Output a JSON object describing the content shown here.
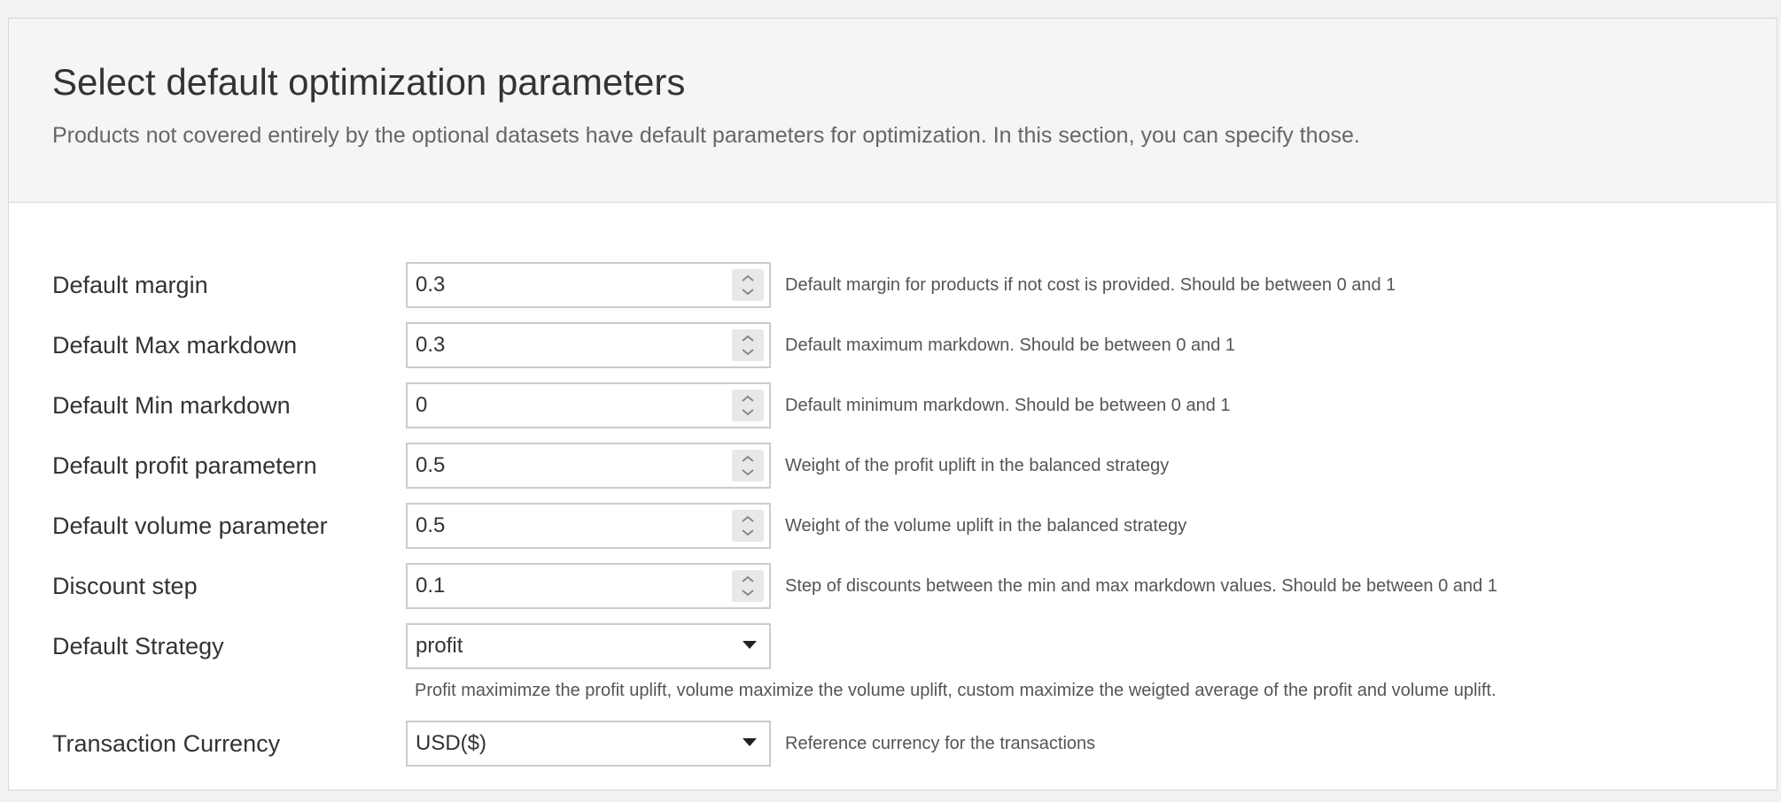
{
  "section": {
    "title": "Select default optimization parameters",
    "description": "Products not covered entirely by the optional datasets have default parameters for optimization. In this section, you can specify those."
  },
  "fields": [
    {
      "label": "Default margin",
      "value": "0.3",
      "help": "Default margin for products if not cost is provided. Should be between 0 and 1"
    },
    {
      "label": "Default Max markdown",
      "value": "0.3",
      "help": "Default maximum markdown. Should be between 0 and 1"
    },
    {
      "label": "Default Min markdown",
      "value": "0",
      "help": "Default minimum markdown. Should be between 0 and 1"
    },
    {
      "label": "Default profit parametern",
      "value": "0.5",
      "help": "Weight of the profit uplift in the balanced strategy"
    },
    {
      "label": "Default volume parameter",
      "value": "0.5",
      "help": "Weight of the volume uplift in the balanced strategy"
    },
    {
      "label": "Discount step",
      "value": "0.1",
      "help": "Step of discounts between the min and max markdown values. Should be between 0 and 1"
    }
  ],
  "strategy": {
    "label": "Default Strategy",
    "selected": "profit",
    "help": "Profit maximimze the profit uplift, volume maximize the volume uplift, custom maximize the weigted average of the profit and volume uplift."
  },
  "currency": {
    "label": "Transaction Currency",
    "selected": "USD($)",
    "help": "Reference currency for the transactions"
  },
  "icons": {
    "stepper": "chevron-up-down-icon",
    "dropdown": "caret-down-icon"
  }
}
